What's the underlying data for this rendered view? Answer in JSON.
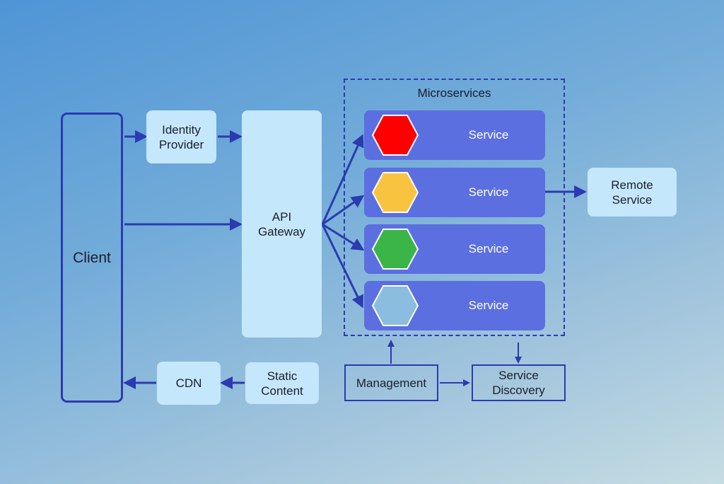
{
  "diagram": {
    "client": {
      "label": "Client"
    },
    "identity_provider": {
      "label": "Identity\nProvider"
    },
    "api_gateway": {
      "label": "API\nGateway"
    },
    "cdn": {
      "label": "CDN"
    },
    "static_content": {
      "label": "Static\nContent"
    },
    "remote_service": {
      "label": "Remote\nService"
    },
    "microservices": {
      "title": "Microservices",
      "services": [
        {
          "label": "Service",
          "color": "#fe0000"
        },
        {
          "label": "Service",
          "color": "#f8c440"
        },
        {
          "label": "Service",
          "color": "#3bb448"
        },
        {
          "label": "Service",
          "color": "#8abde0"
        }
      ]
    },
    "management": {
      "label": "Management"
    },
    "service_discovery": {
      "label": "Service\nDiscovery"
    },
    "colors": {
      "line": "#2b3bb0",
      "light_box": "#c4e7fb",
      "service_box": "#5b6fe0"
    },
    "edges": [
      {
        "from": "Client",
        "to": "Identity Provider"
      },
      {
        "from": "Identity Provider",
        "to": "API Gateway"
      },
      {
        "from": "Client",
        "to": "API Gateway"
      },
      {
        "from": "API Gateway",
        "to": "Service 1"
      },
      {
        "from": "API Gateway",
        "to": "Service 2"
      },
      {
        "from": "API Gateway",
        "to": "Service 3"
      },
      {
        "from": "API Gateway",
        "to": "Service 4"
      },
      {
        "from": "Service 2",
        "to": "Remote Service"
      },
      {
        "from": "CDN",
        "to": "Client"
      },
      {
        "from": "Static Content",
        "to": "CDN"
      },
      {
        "from": "Management",
        "to": "Microservices"
      },
      {
        "from": "Microservices",
        "to": "Service Discovery"
      },
      {
        "from": "Management",
        "to": "Service Discovery"
      }
    ]
  }
}
